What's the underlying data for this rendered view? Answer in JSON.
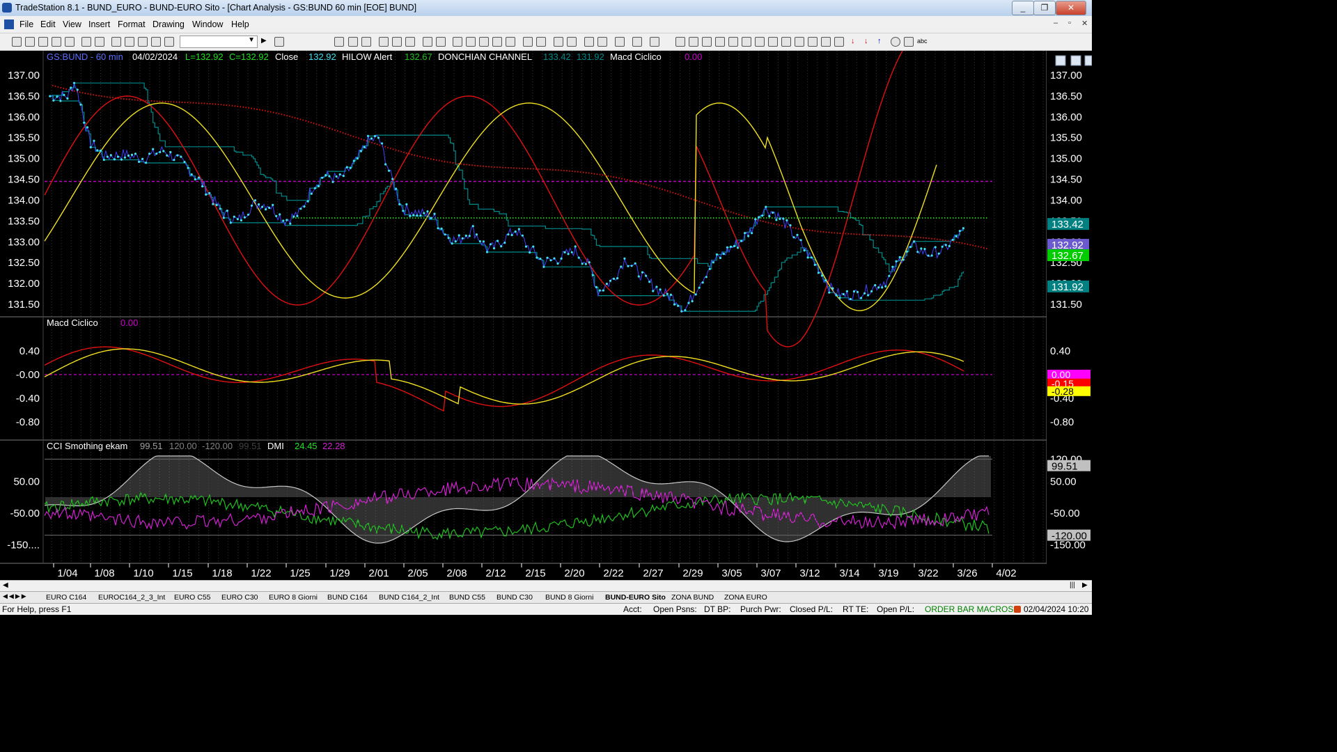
{
  "window": {
    "title": "TradeStation 8.1 - BUND_EURO - BUND-EURO Sito - [Chart Analysis - GS:BUND  60 min  [EOE] BUND]",
    "controls": [
      "_",
      "❐",
      "✕"
    ]
  },
  "menu": {
    "items": [
      "File",
      "Edit",
      "View",
      "Insert",
      "Format",
      "Drawing",
      "Window",
      "Help"
    ],
    "mdi_controls": [
      "–",
      "▫",
      "✕"
    ]
  },
  "chart": {
    "price_pane": {
      "symbol": "GS:BUND - 60 min",
      "date": "04/02/2024",
      "low": "L=132.92",
      "close": "C=132.92",
      "close_label": "Close",
      "close_value": "132.92",
      "hilow_label": "HILOW Alert",
      "hilow_value": "132.67",
      "donchian_label": "DONCHIAN CHANNEL",
      "donchian_upper": "133.42",
      "donchian_lower": "131.92",
      "macd_label": "Macd Ciclico",
      "macd_value": "0.00",
      "y_ticks": [
        "137.00",
        "136.50",
        "136.00",
        "135.50",
        "135.00",
        "134.50",
        "134.00",
        "133.50",
        "133.00",
        "132.50",
        "132.00",
        "131.50"
      ],
      "tags": [
        {
          "value": "133.42",
          "color": "#008080"
        },
        {
          "value": "132.92",
          "color": "#6a5acd"
        },
        {
          "value": "132.67",
          "color": "#00cc00"
        },
        {
          "value": "131.92",
          "color": "#008080"
        }
      ],
      "reference_line": 134.45
    },
    "macd_pane": {
      "label": "Macd Ciclico",
      "value": "0.00",
      "y_ticks": [
        "0.40",
        "-0.00",
        "-0.40",
        "-0.80"
      ],
      "tags": [
        {
          "value": "0.00",
          "color": "#ff00ff"
        },
        {
          "value": "-0.15",
          "color": "#ff0000"
        },
        {
          "value": "-0.28",
          "color": "#ffff00"
        }
      ]
    },
    "cci_pane": {
      "label": "CCI Smothing ekam",
      "values": [
        "99.51",
        "120.00",
        "-120.00",
        "99.51"
      ],
      "dmi_label": "DMI",
      "dmi_plus": "24.45",
      "dmi_minus": "22.28",
      "y_ticks": [
        "50.00",
        "-50.00",
        "-150...."
      ],
      "right_ticks": [
        "120.00",
        "99.51",
        "50.00",
        "-50.00",
        "-120.00",
        "-150.00"
      ]
    },
    "x_axis": [
      "1/04",
      "1/08",
      "1/10",
      "1/15",
      "1/18",
      "1/22",
      "1/25",
      "1/29",
      "2/01",
      "2/05",
      "2/08",
      "2/12",
      "2/15",
      "2/20",
      "2/22",
      "2/27",
      "2/29",
      "3/05",
      "3/07",
      "3/12",
      "3/14",
      "3/19",
      "3/22",
      "3/26",
      "4/02"
    ],
    "colors": {
      "price": "#40e0f0",
      "donchian": "#008b8b",
      "red_cycle": "#e01010",
      "yellow_cycle": "#f0e020",
      "ma_red": "#e01010",
      "ma_green": "#20c020",
      "reference": "#c000c0",
      "dmi_plus": "#20c020",
      "dmi_minus": "#d020d0",
      "cci": "#c8c8c8",
      "cci_fill": "#606060"
    }
  },
  "tabs": [
    "EURO C164",
    "EUROC164_2_3_Int",
    "EURO C55",
    "EURO C30",
    "EURO 8 Giorni",
    "BUND C164",
    "BUND C164_2_Int",
    "BUND C55",
    "BUND  C30",
    "BUND 8 Giorni",
    "BUND-EURO Sito",
    "ZONA BUND",
    "ZONA EURO"
  ],
  "active_tab": "BUND-EURO Sito",
  "status": {
    "help": "For Help, press F1",
    "acct": "Acct:",
    "open_psns": "Open Psns:",
    "dt_bp": "DT BP:",
    "purch_pwr": "Purch Pwr:",
    "closed_pl": "Closed P/L:",
    "rt_te": "RT TE:",
    "open_pl": "Open P/L:",
    "macros": "ORDER BAR  MACROS",
    "datetime": "02/04/2024 10:20"
  }
}
